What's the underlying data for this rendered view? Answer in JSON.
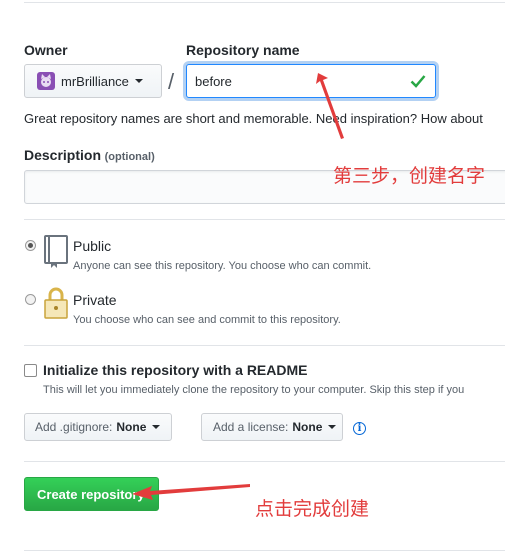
{
  "owner": {
    "label": "Owner",
    "value": "mrBrilliance"
  },
  "separator": "/",
  "repo": {
    "label": "Repository name",
    "value": "before"
  },
  "hint": "Great repository names are short and memorable. Need inspiration? How about",
  "description": {
    "label": "Description",
    "optional": "(optional)",
    "value": ""
  },
  "visibility": {
    "public": {
      "title": "Public",
      "desc": "Anyone can see this repository. You choose who can commit.",
      "selected": true
    },
    "private": {
      "title": "Private",
      "desc": "You choose who can see and commit to this repository.",
      "selected": false
    }
  },
  "readme": {
    "label": "Initialize this repository with a README",
    "desc": "This will let you immediately clone the repository to your computer. Skip this step if you",
    "checked": false
  },
  "gitignore": {
    "label": "Add .gitignore:",
    "value": "None"
  },
  "license": {
    "label": "Add a license:",
    "value": "None"
  },
  "create_button": "Create repository",
  "annotations": {
    "step3": "第三步，创建名字",
    "finish": "点击完成创建"
  },
  "colors": {
    "primary_button": "#2cbe4e",
    "annotation": "#e23c3c",
    "valid_check": "#28a745"
  }
}
